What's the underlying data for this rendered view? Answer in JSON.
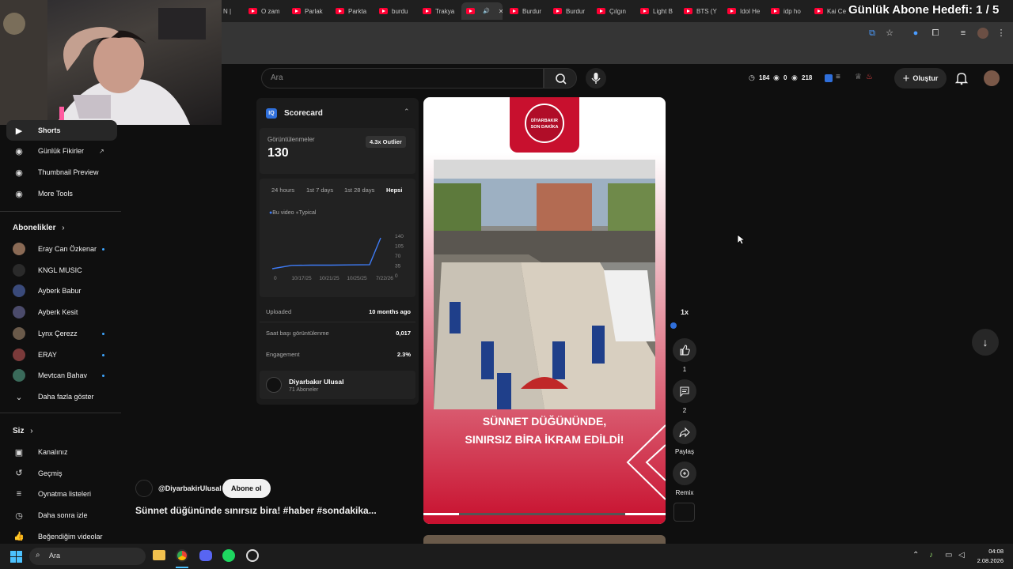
{
  "overlay": {
    "goal_text": "Günlük Abone Hedefi: 1 / 5"
  },
  "tabs": [
    {
      "label": "N |"
    },
    {
      "label": "O zam"
    },
    {
      "label": "Parlak"
    },
    {
      "label": "Parkta"
    },
    {
      "label": "burdu"
    },
    {
      "label": "Trakya"
    },
    {
      "label": ""
    },
    {
      "label": "Burdur"
    },
    {
      "label": "Burdur"
    },
    {
      "label": "Çılgın"
    },
    {
      "label": "Light B"
    },
    {
      "label": "BTS (Y"
    },
    {
      "label": "Idol He"
    },
    {
      "label": "idp ho"
    },
    {
      "label": "Kai Ce"
    }
  ],
  "sidebar": {
    "top_items": [
      {
        "label": "Shorts",
        "icon": "shorts-icon"
      },
      {
        "label": "Günlük Fikirler",
        "icon": "ideas-icon"
      },
      {
        "label": "Thumbnail Preview",
        "icon": "thumbnail-icon"
      },
      {
        "label": "More Tools",
        "icon": "tools-icon"
      }
    ],
    "subscriptions_title": "Abonelikler",
    "subscriptions": [
      {
        "label": "Eray Can Özkenar",
        "new": true,
        "color": "#8a6a55"
      },
      {
        "label": "KNGL MUSIC",
        "new": false,
        "color": "#2a2a2a"
      },
      {
        "label": "Ayberk Babur",
        "new": false,
        "color": "#3a4a7a"
      },
      {
        "label": "Ayberk Kesit",
        "new": false,
        "color": "#4b4b6b"
      },
      {
        "label": "Lynx Çerezz",
        "new": true,
        "color": "#6a5a4a"
      },
      {
        "label": "ERAY",
        "new": true,
        "color": "#7a3a3a"
      },
      {
        "label": "Mevtcan Bahav",
        "new": true,
        "color": "#3a6a5a"
      }
    ],
    "show_more": "Daha fazla göster",
    "you_title": "Siz",
    "you_items": [
      {
        "label": "Kanalınız",
        "icon": "channel-icon"
      },
      {
        "label": "Geçmiş",
        "icon": "history-icon"
      },
      {
        "label": "Oynatma listeleri",
        "icon": "playlist-icon"
      },
      {
        "label": "Daha sonra izle",
        "icon": "watch-later-icon"
      },
      {
        "label": "Beğendiğim videolar",
        "icon": "like-icon"
      }
    ]
  },
  "masthead": {
    "search_placeholder": "Ara",
    "stats": {
      "views_time": "184",
      "zero": "0",
      "eye": "218"
    },
    "create_label": "Oluştur"
  },
  "scorecard": {
    "title": "Scorecard",
    "views_label": "Görüntülenmeler",
    "views_value": "130",
    "outlier": "4.3x Outlier",
    "ranges": [
      "24 hours",
      "1st 7 days",
      "1st 28 days",
      "Hepsi"
    ],
    "legend_this": "Bu video",
    "legend_typical": "Typical",
    "uploaded_label": "Uploaded",
    "uploaded_value": "10 months ago",
    "hourly_label": "Saat başı görüntülenme",
    "hourly_value": "0,017",
    "engagement_label": "Engagement",
    "engagement_value": "2.3%",
    "channel_name": "Diyarbakır Ulusal",
    "channel_subs": "71 Aboneler"
  },
  "chart_data": {
    "type": "line",
    "x_ticks": [
      "0",
      "10/17/25",
      "10/21/25",
      "10/25/25",
      "7/22/26"
    ],
    "y_ticks": [
      "140",
      "105",
      "70",
      "35",
      "0"
    ],
    "series": [
      {
        "name": "Bu video",
        "color": "#3e7bf5",
        "values": [
          0,
          14,
          15,
          15,
          16,
          17,
          130
        ]
      }
    ],
    "ylim": [
      0,
      140
    ]
  },
  "video": {
    "logo_line1": "DİYARBAKIR",
    "logo_line2": "SON DAKİKA",
    "headline_line1": "SÜNNET DÜĞÜNÜNDE,",
    "headline_line2": "SINIRSIZ BİRA İKRAM EDİLDİ!",
    "speed": "1x",
    "likes": "1",
    "comments": "2",
    "share": "Paylaş",
    "remix": "Remix",
    "channel_handle": "@DiyarbakirUlusal",
    "subscribe": "Abone ol",
    "title": "Sünnet düğününde sınırsız bira! #haber #sondakika..."
  },
  "taskbar": {
    "search": "Ara",
    "time": "04:08",
    "date": "2.08.2026"
  }
}
